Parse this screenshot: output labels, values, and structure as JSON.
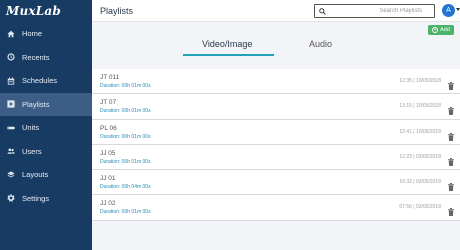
{
  "app": {
    "logo": "MuxLab"
  },
  "sidebar": {
    "items": [
      {
        "label": "Home",
        "icon": "home-icon"
      },
      {
        "label": "Recents",
        "icon": "recents-icon"
      },
      {
        "label": "Schedules",
        "icon": "calendar-icon"
      },
      {
        "label": "Playlists",
        "icon": "playlist-icon",
        "active": true
      },
      {
        "label": "Units",
        "icon": "units-icon"
      },
      {
        "label": "Users",
        "icon": "users-icon"
      },
      {
        "label": "Layouts",
        "icon": "layouts-icon"
      },
      {
        "label": "Settings",
        "icon": "gear-icon"
      }
    ]
  },
  "header": {
    "title": "Playlists",
    "search_placeholder": "Search Playlists",
    "avatar_letter": "A"
  },
  "toolbar": {
    "add_label": "Add"
  },
  "tabs": [
    {
      "label": "Video/Image",
      "active": true
    },
    {
      "label": "Audio",
      "active": false
    }
  ],
  "playlists": [
    {
      "name": "JT 011",
      "duration": "Duration: 00h 01m 00s",
      "date": "12:35 | 10/05/2018"
    },
    {
      "name": "JT 07",
      "duration": "Duration: 00h 01m 00s",
      "date": "13:15 | 10/05/2018"
    },
    {
      "name": "PL 06",
      "duration": "Duration: 00h 01m 00s",
      "date": "12:41 | 10/05/2018"
    },
    {
      "name": "JJ 05",
      "duration": "Duration: 00h 01m 00s",
      "date": "12:23 | 03/05/2018"
    },
    {
      "name": "JJ 01",
      "duration": "Duration: 00h 04m 00s",
      "date": "16:32 | 03/05/2018"
    },
    {
      "name": "JJ 02",
      "duration": "Duration: 00h 01m 00s",
      "date": "07:56 | 03/05/2018"
    }
  ],
  "colors": {
    "sidebar": "#173b63",
    "sidebar_active": "#3b5d86",
    "accent_tab": "#1fa3b5",
    "add_button": "#4cb36a",
    "avatar": "#2276d2",
    "duration_text": "#2a8bb4"
  }
}
